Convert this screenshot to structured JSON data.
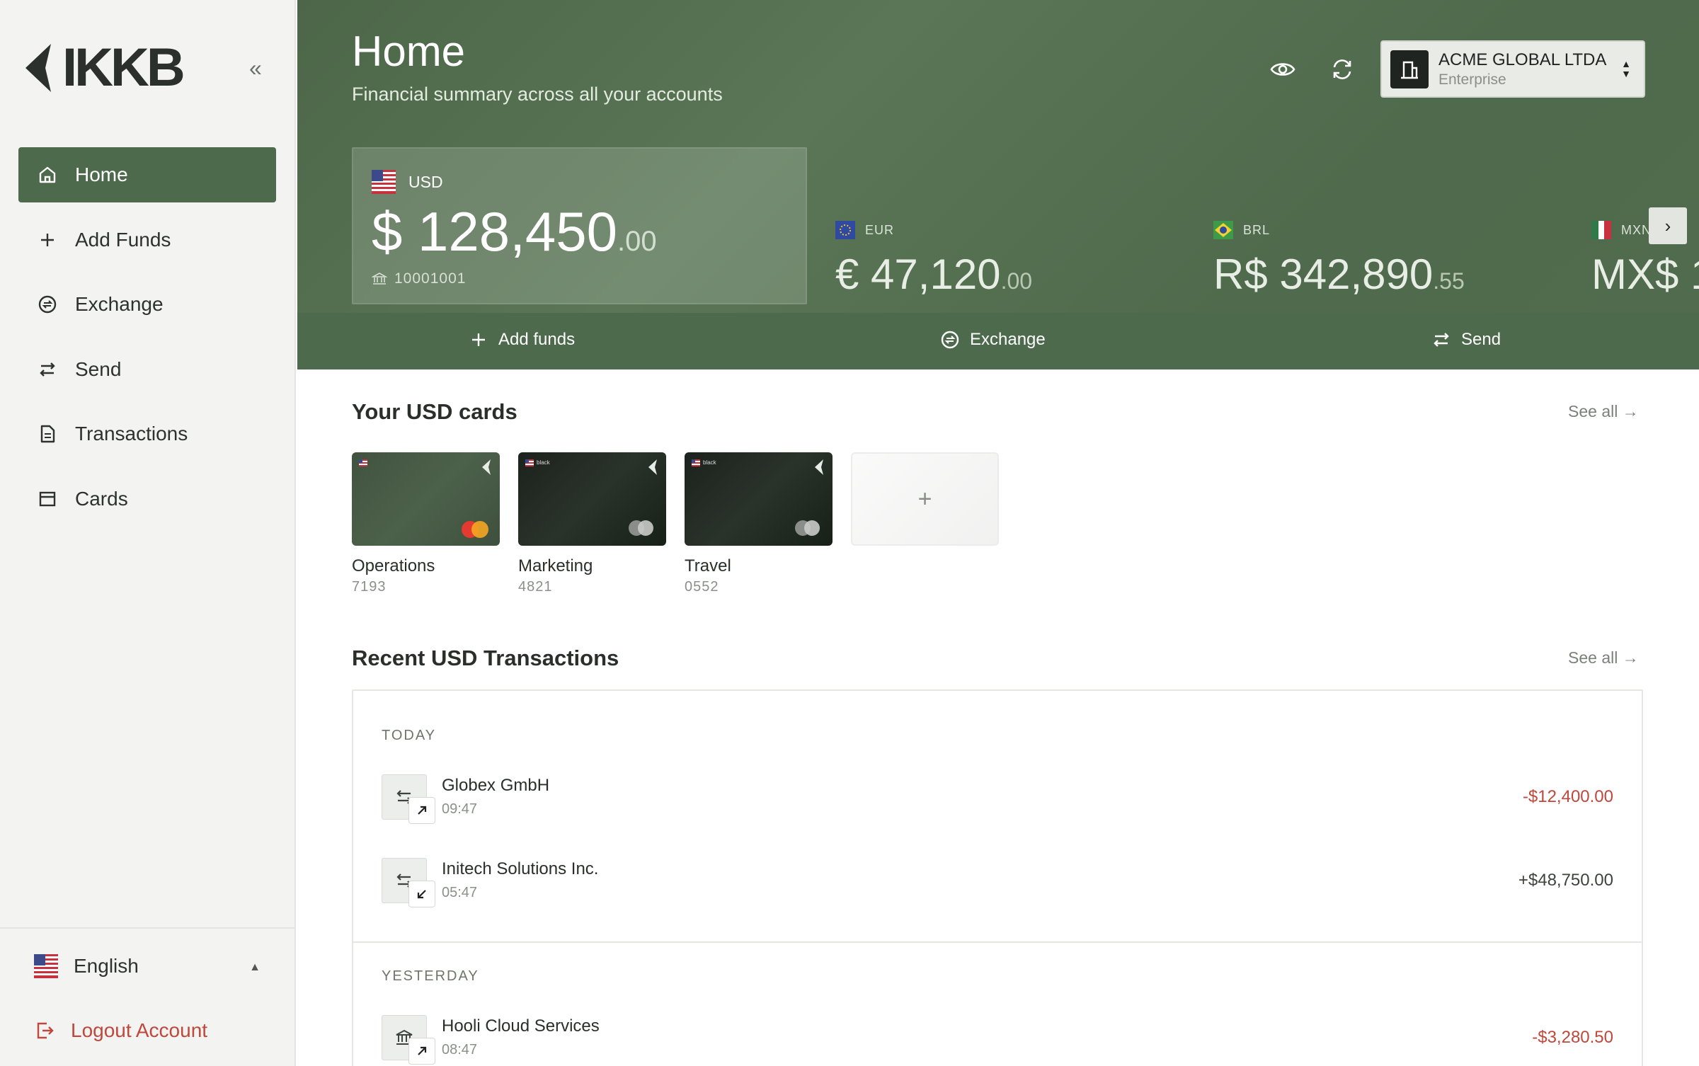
{
  "brand": {
    "name": "IKKB"
  },
  "sidebar": {
    "collapse_glyph": "«",
    "items": [
      {
        "label": "Home",
        "icon": "home-icon",
        "active": true
      },
      {
        "label": "Add Funds",
        "icon": "plus-icon"
      },
      {
        "label": "Exchange",
        "icon": "exchange-icon"
      },
      {
        "label": "Send",
        "icon": "send-icon"
      },
      {
        "label": "Transactions",
        "icon": "document-icon"
      },
      {
        "label": "Cards",
        "icon": "card-icon"
      }
    ],
    "language": "English",
    "logout": "Logout Account"
  },
  "header": {
    "title": "Home",
    "subtitle": "Financial summary across all your accounts",
    "org": {
      "name": "ACME GLOBAL LTDA",
      "plan": "Enterprise"
    }
  },
  "balances": {
    "primary": {
      "currency": "USD",
      "amount": "$ 128,450",
      "decimals": ".00",
      "account": "10001001"
    },
    "others": [
      {
        "currency": "EUR",
        "amount": "€ 47,120",
        "decimals": ".00"
      },
      {
        "currency": "BRL",
        "amount": "R$ 342,890",
        "decimals": ".55"
      },
      {
        "currency": "MXN",
        "amount": "MX$ 1",
        "decimals": ""
      }
    ]
  },
  "actions": {
    "add_funds": "Add funds",
    "exchange": "Exchange",
    "send": "Send"
  },
  "cards_section": {
    "title": "Your USD cards",
    "see_all": "See all →",
    "cards": [
      {
        "label": "Operations",
        "number": "7193",
        "style": "green"
      },
      {
        "label": "Marketing",
        "number": "4821",
        "style": "black",
        "tag": "black"
      },
      {
        "label": "Travel",
        "number": "0552",
        "style": "black",
        "tag": "black"
      }
    ],
    "add_glyph": "+"
  },
  "transactions": {
    "title": "Recent USD Transactions",
    "see_all": "See all →",
    "groups": [
      {
        "label": "TODAY",
        "items": [
          {
            "name": "Globex GmbH",
            "time": "09:47",
            "amount": "-$12,400.00",
            "direction": "out"
          },
          {
            "name": "Initech Solutions Inc.",
            "time": "05:47",
            "amount": "+$48,750.00",
            "direction": "in"
          }
        ]
      },
      {
        "label": "YESTERDAY",
        "items": [
          {
            "name": "Hooli Cloud Services",
            "time": "08:47",
            "amount": "-$3,280.50",
            "direction": "out"
          }
        ]
      }
    ]
  },
  "colors": {
    "accent": "#4e6a4d",
    "negative": "#c0473c",
    "sidebar_bg": "#f3f3f1"
  }
}
